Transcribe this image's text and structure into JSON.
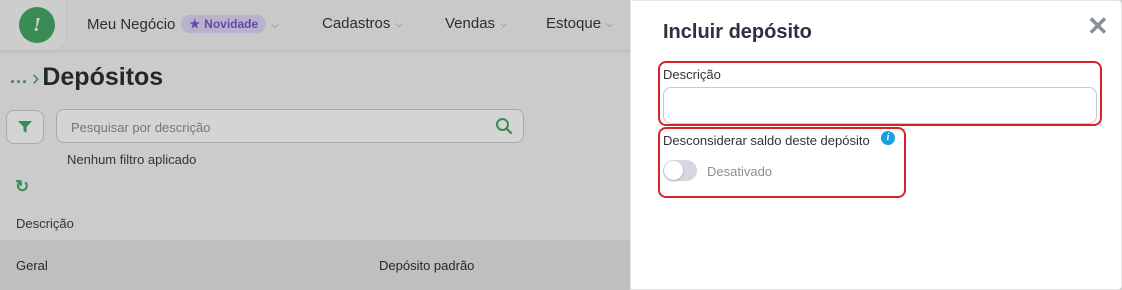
{
  "nav": {
    "items": [
      {
        "label": "Meu Negócio",
        "badge": "Novidade"
      },
      {
        "label": "Cadastros"
      },
      {
        "label": "Vendas"
      },
      {
        "label": "Estoque"
      }
    ]
  },
  "breadcrumb": {
    "ellipsis": "...",
    "title": "Depósitos"
  },
  "search": {
    "placeholder": "Pesquisar por descrição"
  },
  "filter_status": "Nenhum filtro aplicado",
  "table": {
    "headers": [
      "Descrição"
    ],
    "rows": [
      {
        "description": "Geral",
        "tag": "Depósito padrão"
      }
    ]
  },
  "drawer": {
    "title": "Incluir depósito",
    "description_label": "Descrição",
    "description_value": "",
    "disregard_label": "Desconsiderar saldo deste depósito",
    "toggle_state_label": "Desativado",
    "toggle_on": false
  },
  "colors": {
    "brand_green": "#3aa35b",
    "badge_purple": "#6a4fc7",
    "highlight_red": "#d6232a",
    "info_blue": "#1aa0dc"
  },
  "icons": [
    "logo-icon",
    "star-icon",
    "chevron-down-icon",
    "filter-icon",
    "search-icon",
    "refresh-icon",
    "close-icon",
    "info-icon"
  ]
}
